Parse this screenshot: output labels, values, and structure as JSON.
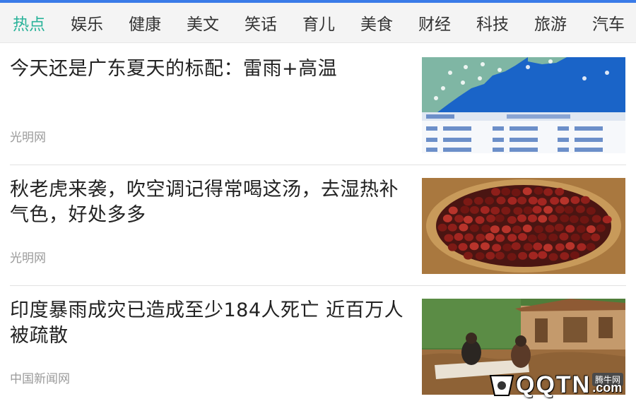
{
  "tabs": [
    {
      "label": "热点",
      "active": true
    },
    {
      "label": "娱乐",
      "active": false
    },
    {
      "label": "健康",
      "active": false
    },
    {
      "label": "美文",
      "active": false
    },
    {
      "label": "笑话",
      "active": false
    },
    {
      "label": "育儿",
      "active": false
    },
    {
      "label": "美食",
      "active": false
    },
    {
      "label": "财经",
      "active": false
    },
    {
      "label": "科技",
      "active": false
    },
    {
      "label": "旅游",
      "active": false
    },
    {
      "label": "汽车",
      "active": false
    }
  ],
  "colors": {
    "accent": "#2bb39a",
    "top_bar": "#3a7be8",
    "tab_text": "#333333",
    "source_text": "#9a9a9a"
  },
  "news": [
    {
      "title": "今天还是广东夏天的标配：雷雨+高温",
      "source": "光明网",
      "thumb": "weather-map-image"
    },
    {
      "title": "秋老虎来袭，吹空调记得常喝这汤，去湿热补气色，好处多多",
      "source": "光明网",
      "thumb": "red-berries-basket-image"
    },
    {
      "title": "印度暴雨成灾已造成至少184人死亡 近百万人被疏散",
      "source": "中国新闻网",
      "thumb": "flood-scene-image"
    }
  ],
  "watermark": {
    "badge": "腾牛网",
    "text": "QQTN",
    "suffix": ".com"
  }
}
